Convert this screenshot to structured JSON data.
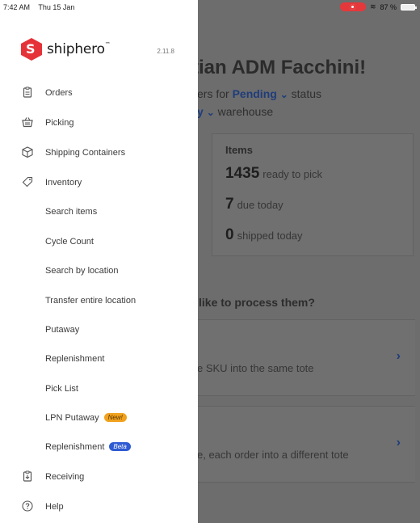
{
  "status_bar": {
    "time": "7:42 AM",
    "date": "Thu 15 Jan",
    "battery": "87 %"
  },
  "brand": {
    "name": "shiphero",
    "trademark": "™",
    "version": "2.11.8"
  },
  "drawer": {
    "items": [
      {
        "label": "Orders",
        "icon": "clipboard-icon"
      },
      {
        "label": "Picking",
        "icon": "basket-icon"
      },
      {
        "label": "Shipping Containers",
        "icon": "box-icon"
      },
      {
        "label": "Inventory",
        "icon": "tag-icon"
      },
      {
        "label": "Search items"
      },
      {
        "label": "Cycle Count"
      },
      {
        "label": "Search by location"
      },
      {
        "label": "Transfer entire location"
      },
      {
        "label": "Putaway"
      },
      {
        "label": "Replenishment"
      },
      {
        "label": "Pick List"
      },
      {
        "label": "LPN Putaway",
        "badge": "New!"
      },
      {
        "label": "Replenishment",
        "badge": "Beta"
      },
      {
        "label": "Receiving",
        "icon": "receiving-icon"
      },
      {
        "label": "Help",
        "icon": "help-icon"
      }
    ]
  },
  "background": {
    "title": "tian ADM Facchini!",
    "line1_prefix": "ers for",
    "line1_link": "Pending",
    "line1_suffix": "status",
    "line2_link": "y",
    "line2_suffix": "warehouse",
    "card_title": "Items",
    "stats": [
      {
        "value": "1435",
        "text": "ready to pick"
      },
      {
        "value": "7",
        "text": "due today"
      },
      {
        "value": "0",
        "text": "shipped today"
      }
    ],
    "question": "like to process them?",
    "option1": "e SKU into the same tote",
    "option2": "e, each order into a different tote"
  },
  "colors": {
    "brand": "#e53238",
    "new_badge": "#f0a21f",
    "beta_badge": "#2f5bd3",
    "link": "#1f3d7a"
  }
}
